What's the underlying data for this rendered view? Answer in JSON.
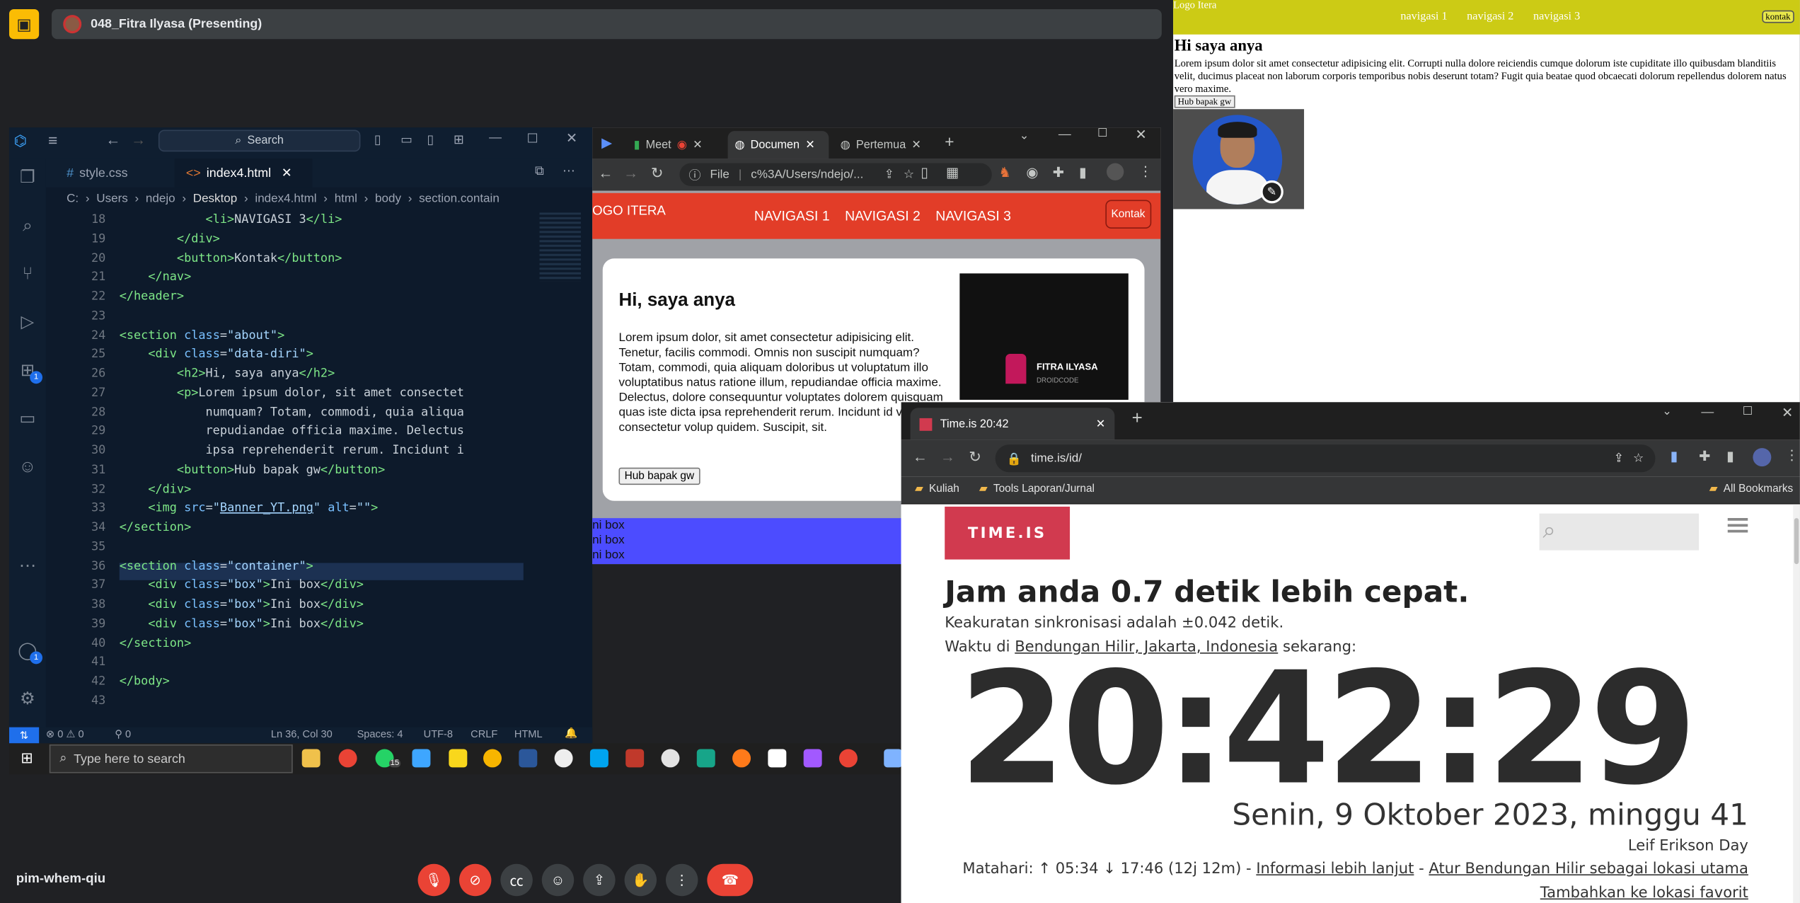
{
  "meet": {
    "presenter_label": "048_Fitra Ilyasa (Presenting)",
    "meeting_code": "pim-whem-qiu",
    "buttons": [
      "mic-off-icon",
      "camera-off-icon",
      "captions-icon",
      "emoji-icon",
      "present-icon",
      "raise-hand-icon",
      "more-icon",
      "end-call-icon"
    ]
  },
  "site_preview": {
    "logo": "Logo Itera",
    "nav": [
      "navigasi 1",
      "navigasi 2",
      "navigasi 3"
    ],
    "kontak": "kontak",
    "heading": "Hi saya anya",
    "paragraph": "Lorem ipsum dolor sit amet consectetur adipisicing elit. Corrupti nulla dolore reiciendis cumque dolorum iste cupiditate illo quibusdam blanditiis velit, ducimus placeat non laborum corporis temporibus nobis deserunt totam? Fugit quia beatae quod obcaecati dolorum repellendus dolorem natus vero maxime.",
    "button": "Hub bapak gw"
  },
  "vscode": {
    "search": "Search",
    "tabs": [
      {
        "label": "style.css",
        "icon": "#"
      },
      {
        "label": "index4.html",
        "icon": "<>"
      }
    ],
    "breadcrumb": [
      "C:",
      "Users",
      "ndejo",
      "Desktop",
      "index4.html",
      "html",
      "body",
      "section.contain"
    ],
    "lines": [
      {
        "n": "18",
        "html": "            <span class='tag'>&lt;li&gt;</span>NAVIGASI 3<span class='tag'>&lt;/li&gt;</span>"
      },
      {
        "n": "19",
        "html": "        <span class='tag'>&lt;/div&gt;</span>"
      },
      {
        "n": "20",
        "html": "        <span class='tag'>&lt;button&gt;</span>Kontak<span class='tag'>&lt;/button&gt;</span>"
      },
      {
        "n": "21",
        "html": "    <span class='tag'>&lt;/nav&gt;</span>"
      },
      {
        "n": "22",
        "html": "<span class='tag'>&lt;/header&gt;</span>"
      },
      {
        "n": "23",
        "html": ""
      },
      {
        "n": "24",
        "html": "<span class='tag'>&lt;section</span> <span class='att'>class</span>=<span class='str'>\"about\"</span><span class='tag'>&gt;</span>"
      },
      {
        "n": "25",
        "html": "    <span class='tag'>&lt;div</span> <span class='att'>class</span>=<span class='str'>\"data-diri\"</span><span class='tag'>&gt;</span>"
      },
      {
        "n": "26",
        "html": "        <span class='tag'>&lt;h2&gt;</span>Hi, saya anya<span class='tag'>&lt;/h2&gt;</span>"
      },
      {
        "n": "27",
        "html": "        <span class='tag'>&lt;p&gt;</span>Lorem ipsum dolor, sit amet consectet"
      },
      {
        "n": "28",
        "html": "            numquam? Totam, commodi, quia aliqua"
      },
      {
        "n": "29",
        "html": "            repudiandae officia maxime. Delectus"
      },
      {
        "n": "30",
        "html": "            ipsa reprehenderit rerum. Incidunt i"
      },
      {
        "n": "31",
        "html": "        <span class='tag'>&lt;button&gt;</span>Hub bapak gw<span class='tag'>&lt;/button&gt;</span>"
      },
      {
        "n": "32",
        "html": "    <span class='tag'>&lt;/div&gt;</span>"
      },
      {
        "n": "33",
        "html": "    <span class='tag'>&lt;img</span> <span class='att'>src</span>=<span class='str'>\"<u>Banner_YT.png</u>\"</span> <span class='att'>alt</span>=<span class='str'>\"\"</span><span class='tag'>&gt;</span>"
      },
      {
        "n": "34",
        "html": "<span class='tag'>&lt;/section&gt;</span>"
      },
      {
        "n": "35",
        "html": ""
      },
      {
        "n": "36",
        "html": "<span class='tag'>&lt;section</span> <span class='att'>class</span>=<span class='str'>\"container\"</span><span class='tag'>&gt;</span>"
      },
      {
        "n": "37",
        "html": "    <span class='tag'>&lt;div</span> <span class='att'>class</span>=<span class='str'>\"box\"</span><span class='tag'>&gt;</span>Ini box<span class='tag'>&lt;/div&gt;</span>"
      },
      {
        "n": "38",
        "html": "    <span class='tag'>&lt;div</span> <span class='att'>class</span>=<span class='str'>\"box\"</span><span class='tag'>&gt;</span>Ini box<span class='tag'>&lt;/div&gt;</span>"
      },
      {
        "n": "39",
        "html": "    <span class='tag'>&lt;div</span> <span class='att'>class</span>=<span class='str'>\"box\"</span><span class='tag'>&gt;</span>Ini box<span class='tag'>&lt;/div&gt;</span>"
      },
      {
        "n": "40",
        "html": "<span class='tag'>&lt;/section&gt;</span>"
      },
      {
        "n": "41",
        "html": ""
      },
      {
        "n": "42",
        "html": "<span class='tag'>&lt;/body&gt;</span>"
      },
      {
        "n": "43",
        "html": ""
      }
    ],
    "status": {
      "errors": "0",
      "warnings": "0",
      "ports": "0",
      "position": "Ln 36, Col 30",
      "spaces": "Spaces: 4",
      "encoding": "UTF-8",
      "eol": "CRLF",
      "language": "HTML"
    }
  },
  "browser1": {
    "tabs": [
      "Meet",
      "Documen",
      "Pertemua"
    ],
    "address": "c%3A/Users/ndejo/...",
    "file_label": "File",
    "logo": "OGO ITERA",
    "nav": [
      "NAVIGASI 1",
      "NAVIGASI 2",
      "NAVIGASI 3"
    ],
    "kontak": "Kontak",
    "heading": "Hi, saya anya",
    "paragraph": "Lorem ipsum dolor, sit amet consectetur adipisicing elit. Tenetur, facilis commodi. Omnis non suscipit numquam? Totam, commodi, quia aliquam doloribus ut voluptatum illo voluptatibus natus ratione illum, repudiandae officia maxime. Delectus, dolore consequuntur voluptates dolorem quisquam quas iste dicta ipsa reprehenderit rerum. Incidunt id voluptatem consectetur volup quidem. Suscipit, sit.",
    "button": "Hub bapak gw",
    "banner_text": [
      "FITRA ILYASA",
      "DROIDCODE"
    ],
    "boxes": [
      "ni box",
      "ni box",
      "ni box"
    ]
  },
  "taskbar": {
    "search_placeholder": "Type here to search",
    "whatsapp_badge": "15"
  },
  "browser2": {
    "tab_title": "Time.is 20:42",
    "address": "time.is/id/",
    "bookmarks": [
      "Kuliah",
      "Tools Laporan/Jurnal"
    ],
    "all_bookmarks": "All Bookmarks",
    "logo": "TIME.IS",
    "headline": "Jam anda 0.7 detik lebih cepat.",
    "sync": "Keakuratan sinkronisasi adalah ±0.042 detik.",
    "location_prefix": "Waktu di",
    "location_place": "Bendungan Hilir, Jakarta, Indonesia",
    "location_suffix": "sekarang:",
    "clock": "20:42:29",
    "date": "Senin, 9 Oktober 2023, minggu 41",
    "holiday": "Leif Erikson Day",
    "sun_prefix": "Matahari: ↑ 05:34 ↓ 17:46 (12j 12m) -",
    "more_info": "Informasi lebih lanjut",
    "set_location": "Atur Bendungan Hilir sebagai lokasi utama",
    "add_fav": "Tambahkan ke lokasi favorit"
  },
  "colors": {
    "meet_bg": "#202124",
    "vscode_bg": "#0d1a2b",
    "site_header": "#e23d28",
    "site_nav_yellow": "#cccb15",
    "box_blue": "#4c4cff",
    "timeis_red": "#d13a4f",
    "end_call": "#ea4335"
  }
}
